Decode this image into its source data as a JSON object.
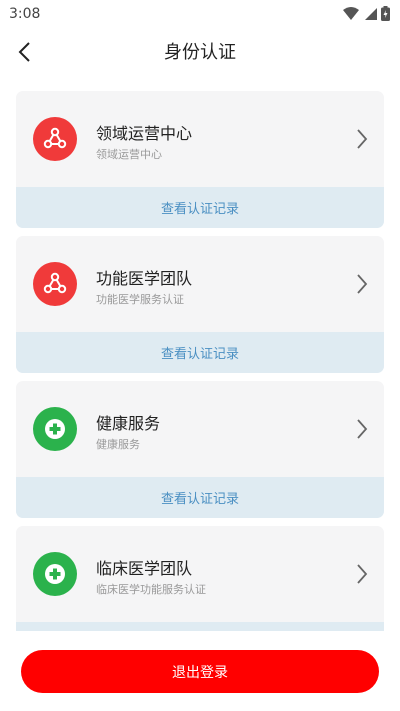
{
  "status_bar": {
    "time": "3:08"
  },
  "nav": {
    "title": "身份认证",
    "back_icon": "chevron-left-icon"
  },
  "colors": {
    "red": "#f03a3a",
    "green": "#2bb24c",
    "footer_bg": "#dfebf2",
    "footer_text": "#4a8fc2",
    "logout": "#ff0000"
  },
  "cards": [
    {
      "title": "领域运营中心",
      "subtitle": "领域运营中心",
      "footer": "查看认证记录",
      "icon": "network-share-icon",
      "icon_color": "red"
    },
    {
      "title": "功能医学团队",
      "subtitle": "功能医学服务认证",
      "footer": "查看认证记录",
      "icon": "network-share-icon",
      "icon_color": "red"
    },
    {
      "title": "健康服务",
      "subtitle": "健康服务",
      "footer": "查看认证记录",
      "icon": "medical-plus-icon",
      "icon_color": "green"
    },
    {
      "title": "临床医学团队",
      "subtitle": "临床医学功能服务认证",
      "footer": "",
      "icon": "medical-plus-icon",
      "icon_color": "green"
    }
  ],
  "logout_label": "退出登录"
}
